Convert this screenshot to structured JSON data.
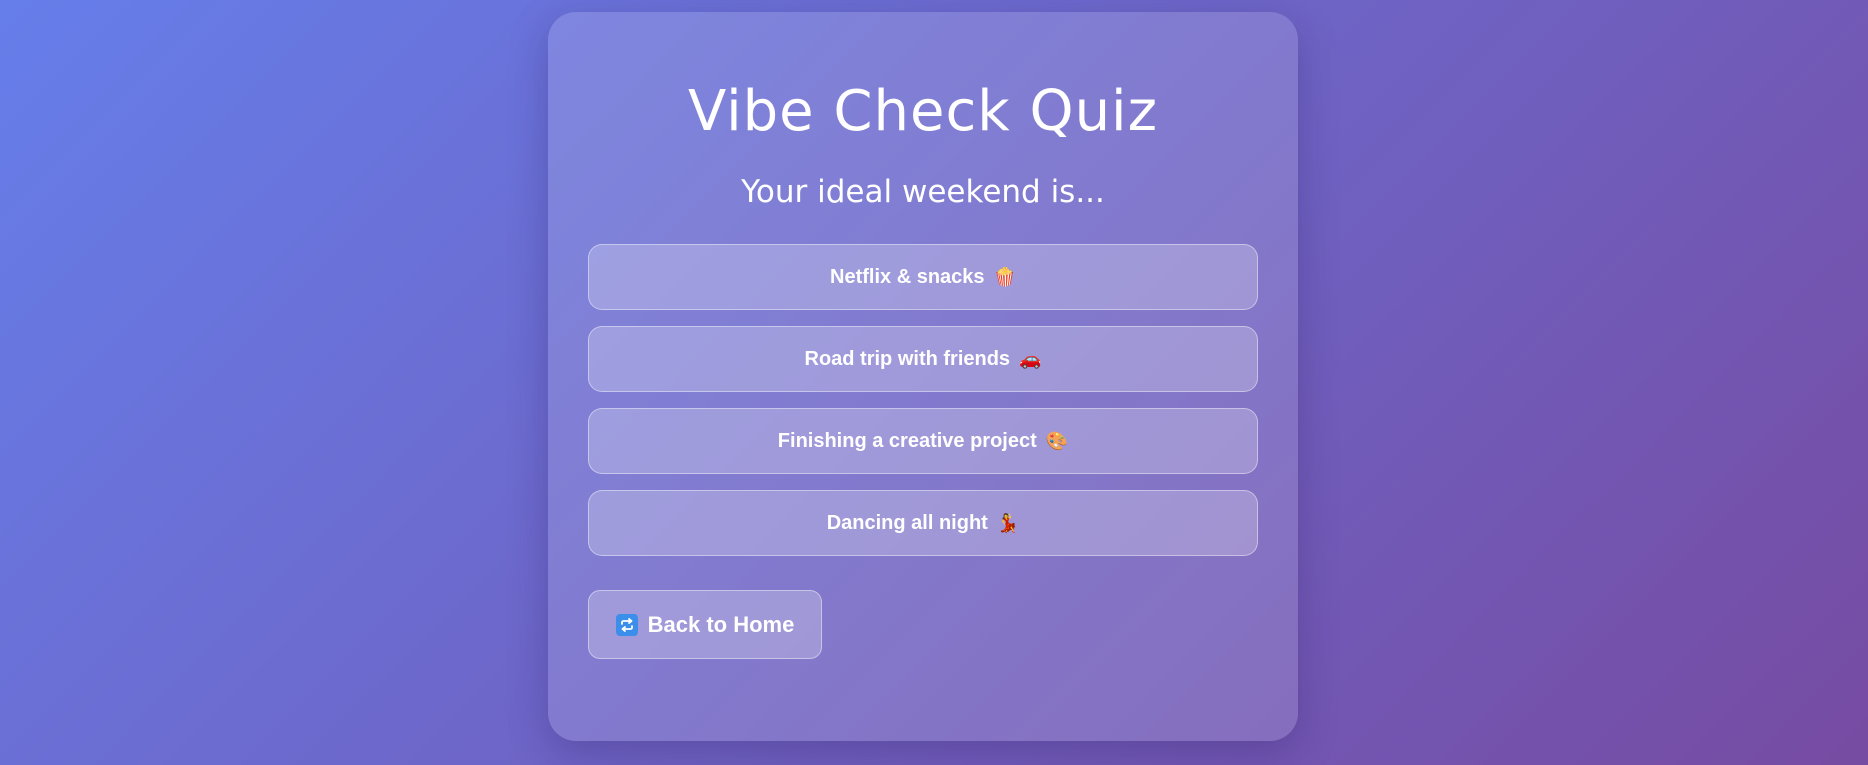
{
  "quiz": {
    "title": "Vibe Check Quiz",
    "question": "Your ideal weekend is...",
    "options": [
      {
        "label": "Netflix & snacks",
        "emoji": "🍿",
        "icon": "popcorn-icon"
      },
      {
        "label": "Road trip with friends",
        "emoji": "🚗",
        "icon": "car-icon"
      },
      {
        "label": "Finishing a creative project",
        "emoji": "🎨",
        "icon": "palette-icon"
      },
      {
        "label": "Dancing all night",
        "emoji": "💃",
        "icon": "dancer-icon"
      }
    ]
  },
  "back_button": {
    "label": "Back to Home",
    "icon": "repeat-icon"
  },
  "colors": {
    "background_start": "#667eea",
    "background_end": "#764ba2",
    "text": "#ffffff",
    "icon_blue": "#3b8eea"
  }
}
